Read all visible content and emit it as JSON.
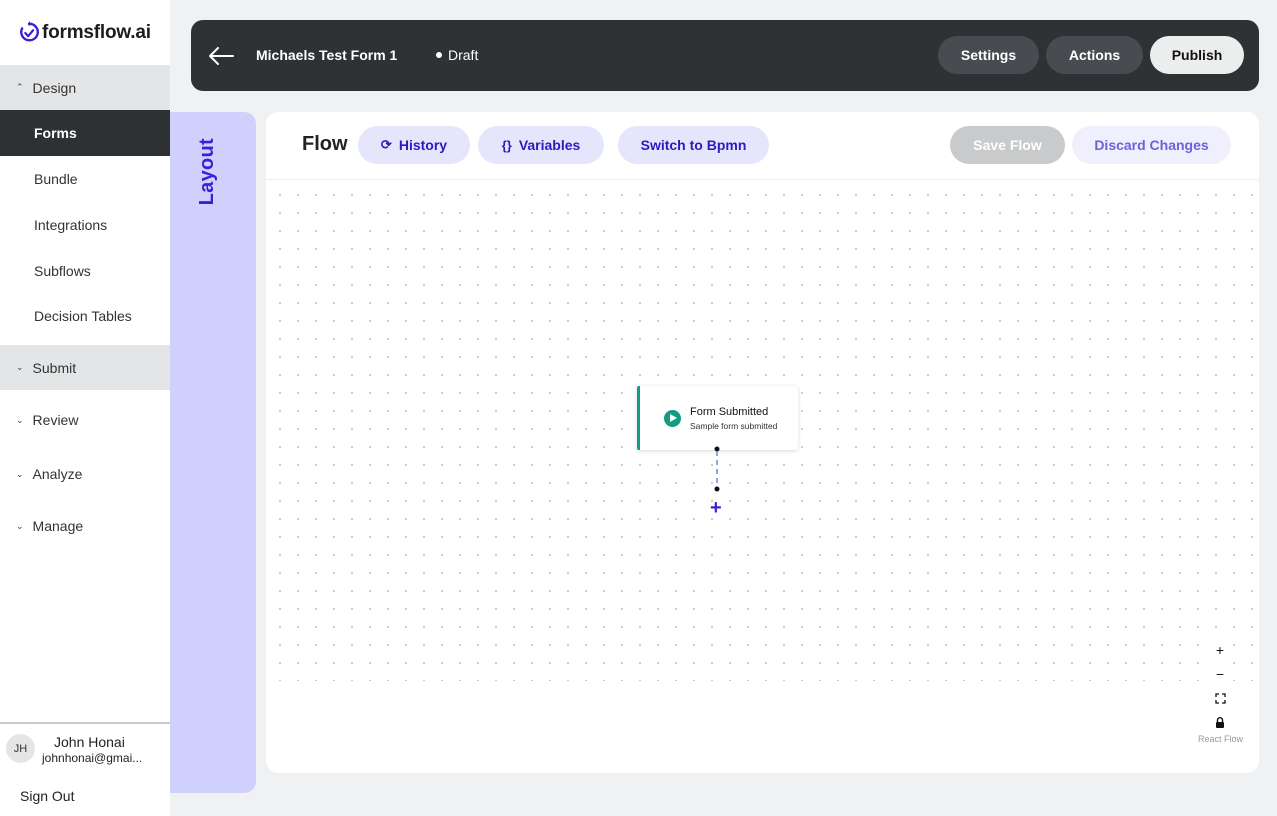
{
  "brand": {
    "name": "formsflow.ai"
  },
  "sidebar": {
    "sections": [
      {
        "label": "Design",
        "expanded": true,
        "items": [
          "Forms",
          "Bundle",
          "Integrations",
          "Subflows",
          "Decision Tables"
        ],
        "selected": "Forms"
      },
      {
        "label": "Submit",
        "expanded": false
      },
      {
        "label": "Review",
        "expanded": false
      },
      {
        "label": "Analyze",
        "expanded": false
      },
      {
        "label": "Manage",
        "expanded": false
      }
    ],
    "user": {
      "initials": "JH",
      "name": "John Honai",
      "email": "johnhonai@gmai..."
    },
    "sign_out": "Sign Out"
  },
  "topbar": {
    "form_title": "Michaels Test Form 1",
    "status": "Draft",
    "settings": "Settings",
    "actions": "Actions",
    "publish": "Publish"
  },
  "layout_rail": {
    "label": "Layout"
  },
  "flow": {
    "title": "Flow",
    "history": "History",
    "variables": "Variables",
    "variables_icon": "{}",
    "switch": "Switch to Bpmn",
    "save": "Save Flow",
    "discard": "Discard Changes",
    "node": {
      "title": "Form Submitted",
      "subtitle": "Sample form submitted"
    },
    "controls": {
      "zoom_in": "+",
      "zoom_out": "−"
    },
    "attribution": "React Flow"
  },
  "colors": {
    "accent": "#3b1fd6",
    "node_accent": "#129c80",
    "topbar": "#2f3235",
    "rail": "#cfd0fc"
  }
}
